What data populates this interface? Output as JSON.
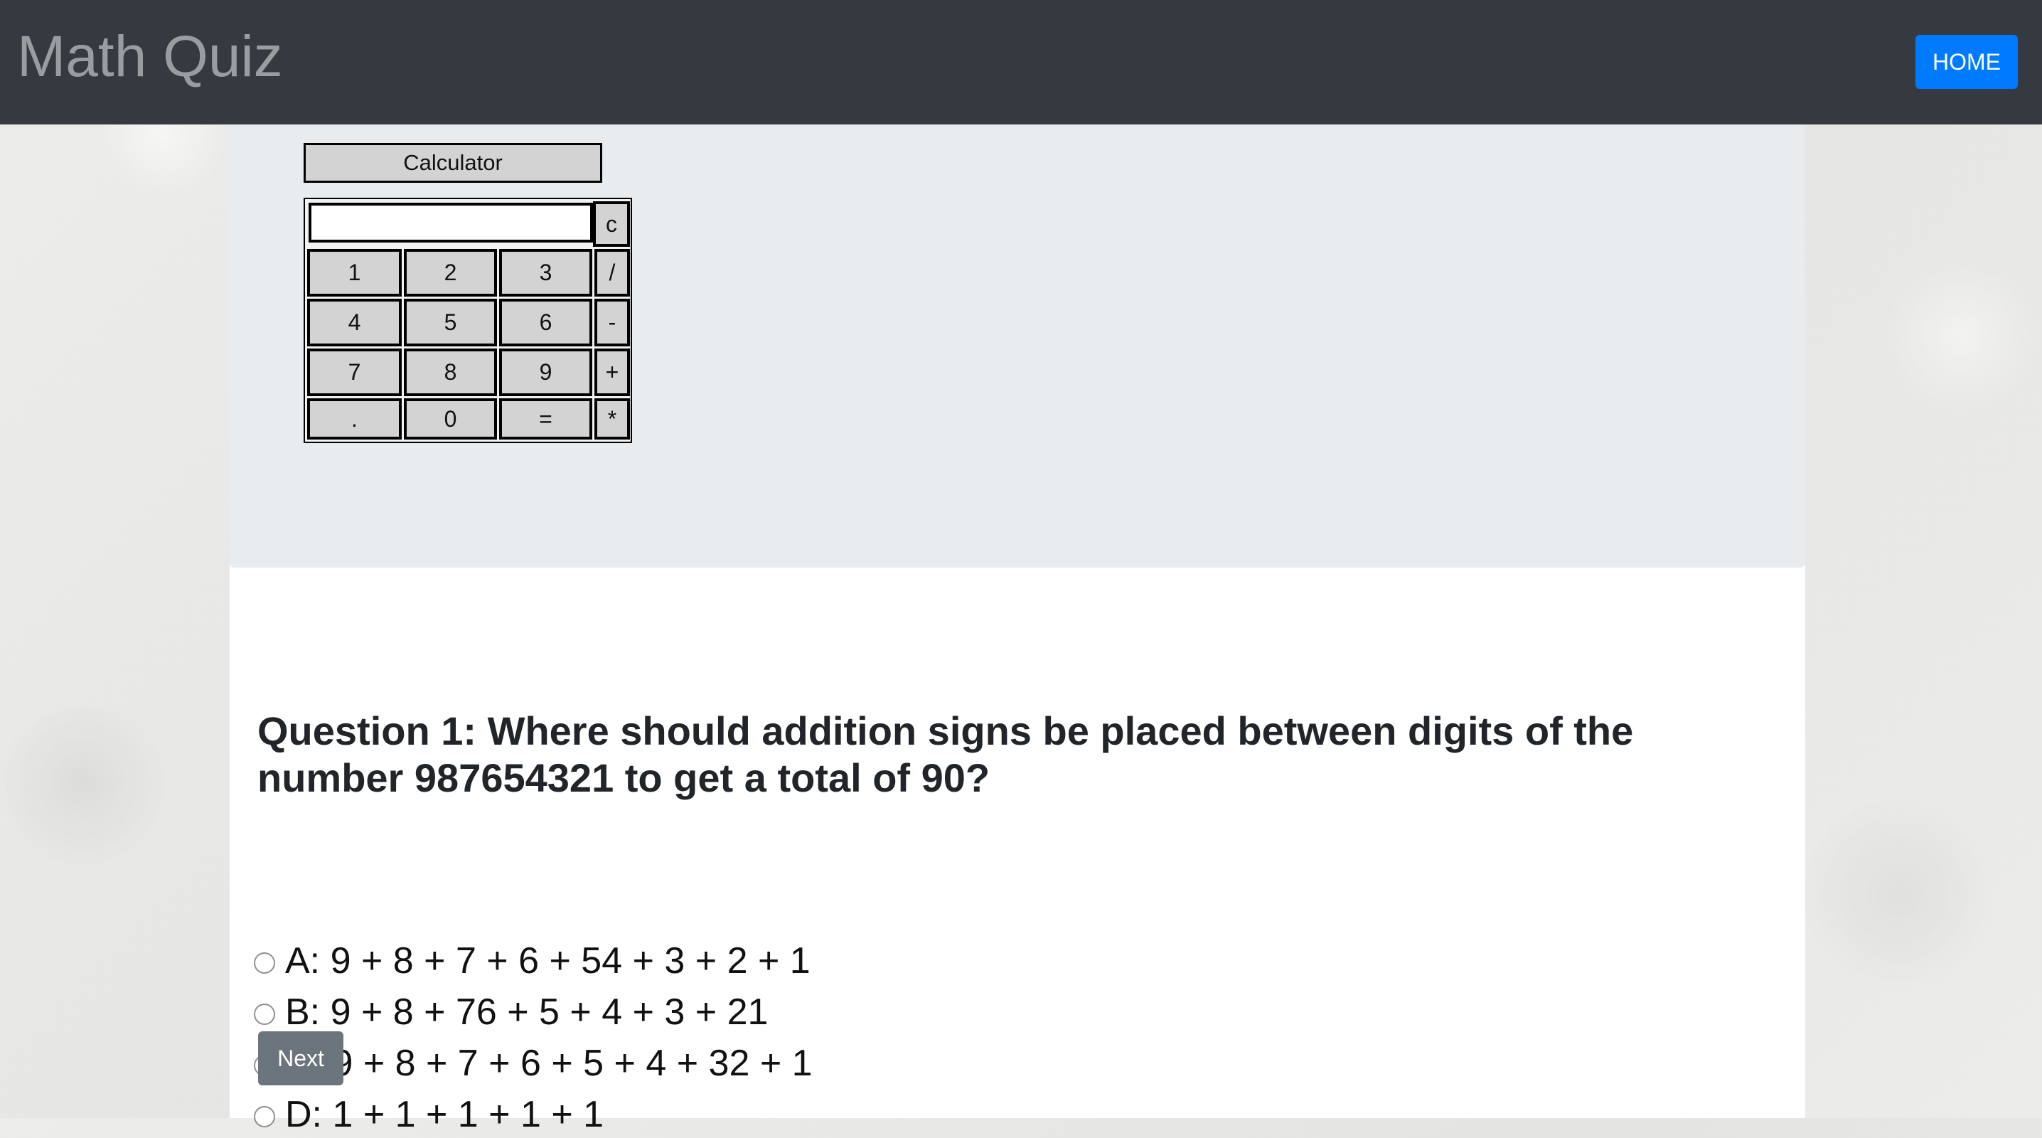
{
  "navbar": {
    "brand": "Math Quiz",
    "home_label": "HOME"
  },
  "calculator": {
    "title": "Calculator",
    "display_value": "",
    "clear_label": "c",
    "keys": {
      "k1": "1",
      "k2": "2",
      "k3": "3",
      "div": "/",
      "k4": "4",
      "k5": "5",
      "k6": "6",
      "sub": "-",
      "k7": "7",
      "k8": "8",
      "k9": "9",
      "add": "+",
      "dot": ".",
      "k0": "0",
      "eq": "=",
      "mul": "*"
    }
  },
  "quiz": {
    "question": "Question 1: Where should addition signs be placed between digits of the number 987654321 to get a total of 90?",
    "options": [
      "A: 9 + 8 + 7 + 6 + 54 + 3 + 2 + 1",
      "B: 9 + 8 + 76 + 5 + 4 + 3 + 21",
      "C: 9 + 8 + 7 + 6 + 5 + 4 + 32 + 1",
      "D: 1 + 1 + 1 + 1 + 1"
    ],
    "next_label": "Next"
  },
  "colors": {
    "navbar_bg": "#343a40",
    "brand_text": "#9a9da0",
    "home_button": "#007bff",
    "next_button": "#6c757d",
    "jumbotron_bg": "#e9ecef",
    "calc_key_bg": "#d3d3d3"
  }
}
